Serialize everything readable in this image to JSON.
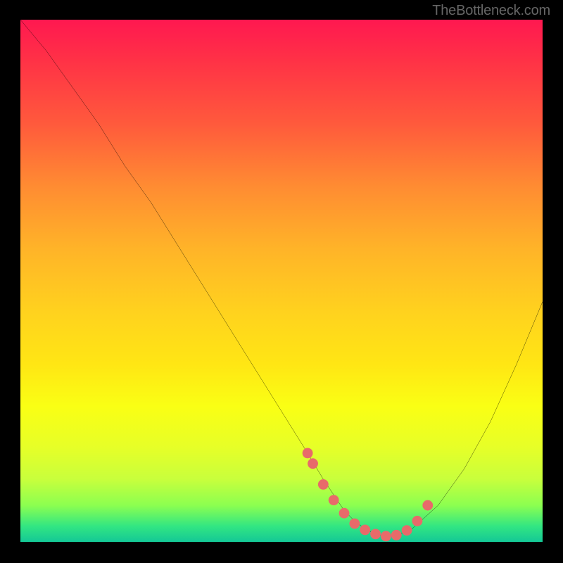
{
  "watermark": "TheBottleneck.com",
  "chart_data": {
    "type": "line",
    "title": "",
    "xlabel": "",
    "ylabel": "",
    "xlim": [
      0,
      100
    ],
    "ylim": [
      0,
      100
    ],
    "grid": false,
    "series": [
      {
        "name": "curve",
        "x": [
          0,
          5,
          10,
          15,
          20,
          25,
          30,
          35,
          40,
          45,
          50,
          55,
          58,
          60,
          62,
          64,
          66,
          68,
          70,
          72,
          75,
          80,
          85,
          90,
          95,
          100
        ],
        "y": [
          100,
          94,
          87,
          80,
          72,
          65,
          57,
          49,
          41,
          33,
          25,
          17,
          12,
          9,
          6,
          4,
          2.5,
          1.5,
          1,
          1.2,
          2.5,
          7,
          14,
          23,
          34,
          46
        ],
        "stroke": "#000000",
        "stroke_width": 2
      }
    ],
    "markers": {
      "name": "lower-points",
      "shape": "circle",
      "fill": "#e86a6a",
      "radius": 7,
      "x": [
        55,
        56,
        58,
        60,
        62,
        64,
        66,
        68,
        70,
        72,
        74,
        76,
        78
      ],
      "y": [
        17,
        15,
        11,
        8,
        5.5,
        3.5,
        2.3,
        1.5,
        1.1,
        1.3,
        2.2,
        4,
        7
      ]
    },
    "background": {
      "type": "vertical-gradient",
      "stops": [
        {
          "pos": 0.0,
          "color": "#ff1850"
        },
        {
          "pos": 0.5,
          "color": "#ffd21e"
        },
        {
          "pos": 0.8,
          "color": "#e6ff28"
        },
        {
          "pos": 1.0,
          "color": "#14c896"
        }
      ]
    }
  }
}
